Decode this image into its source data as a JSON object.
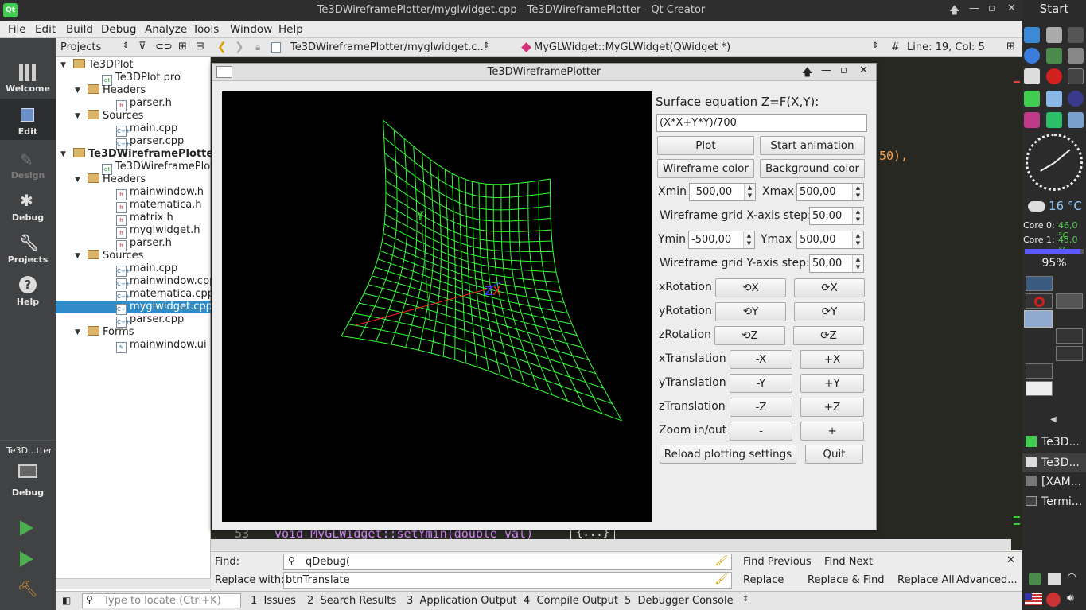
{
  "window": {
    "title": "Te3DWireframePlotter/myglwidget.cpp - Te3DWireframePlotter - Qt Creator"
  },
  "menu": [
    "File",
    "Edit",
    "Build",
    "Debug",
    "Analyze",
    "Tools",
    "Window",
    "Help"
  ],
  "modes": [
    {
      "label": "Welcome",
      "icon": "grid-icon"
    },
    {
      "label": "Edit",
      "icon": "document-icon"
    },
    {
      "label": "Design",
      "icon": "pen-icon"
    },
    {
      "label": "Debug",
      "icon": "bug-icon"
    },
    {
      "label": "Projects",
      "icon": "wrench-icon"
    },
    {
      "label": "Help",
      "icon": "help-icon"
    }
  ],
  "kit": {
    "project": "Te3D...tter",
    "config": "Debug"
  },
  "projects": {
    "header": "Projects",
    "tree": [
      {
        "label": "Te3DPlot",
        "level": 0,
        "type": "project"
      },
      {
        "label": "Te3DPlot.pro",
        "level": 1,
        "type": "pro"
      },
      {
        "label": "Headers",
        "level": 1,
        "type": "folder"
      },
      {
        "label": "parser.h",
        "level": 2,
        "type": "h"
      },
      {
        "label": "Sources",
        "level": 1,
        "type": "folder"
      },
      {
        "label": "main.cpp",
        "level": 2,
        "type": "cpp"
      },
      {
        "label": "parser.cpp",
        "level": 2,
        "type": "cpp"
      },
      {
        "label": "Te3DWireframePlotte",
        "level": 0,
        "type": "project",
        "bold": true
      },
      {
        "label": "Te3DWireframePlotte",
        "level": 1,
        "type": "pro"
      },
      {
        "label": "Headers",
        "level": 1,
        "type": "folder"
      },
      {
        "label": "mainwindow.h",
        "level": 2,
        "type": "h"
      },
      {
        "label": "matematica.h",
        "level": 2,
        "type": "h"
      },
      {
        "label": "matrix.h",
        "level": 2,
        "type": "h"
      },
      {
        "label": "myglwidget.h",
        "level": 2,
        "type": "h"
      },
      {
        "label": "parser.h",
        "level": 2,
        "type": "h"
      },
      {
        "label": "Sources",
        "level": 1,
        "type": "folder"
      },
      {
        "label": "main.cpp",
        "level": 2,
        "type": "cpp"
      },
      {
        "label": "mainwindow.cpp",
        "level": 2,
        "type": "cpp"
      },
      {
        "label": "matematica.cpp",
        "level": 2,
        "type": "cpp"
      },
      {
        "label": "myglwidget.cpp",
        "level": 2,
        "type": "cpp",
        "selected": true
      },
      {
        "label": "parser.cpp",
        "level": 2,
        "type": "cpp"
      },
      {
        "label": "Forms",
        "level": 1,
        "type": "folder"
      },
      {
        "label": "mainwindow.ui",
        "level": 2,
        "type": "ui"
      }
    ]
  },
  "editor": {
    "file": "Te3DWireframePlotter/myglwidget.c...",
    "symbol": "MyGLWidget::MyGLWidget(QWidget *)",
    "hash": "#",
    "position": "Line: 19, Col: 5",
    "visible_code_fragment": "50),",
    "bottom_line_no": "53",
    "bottom_line_code": "void MyGLWidget::setYmin(double val)",
    "fold": "{...}"
  },
  "find": {
    "find_label": "Find:",
    "find_value": "qDebug(",
    "replace_label": "Replace with:",
    "replace_value": "btnTranslate",
    "find_previous": "Find Previous",
    "find_next": "Find Next",
    "replace": "Replace",
    "replace_find": "Replace & Find",
    "replace_all": "Replace All",
    "advanced": "Advanced..."
  },
  "status": {
    "locate_placeholder": "Type to locate (Ctrl+K)",
    "panes": [
      "1  Issues",
      "2  Search Results",
      "3  Application Output",
      "4  Compile Output",
      "5  Debugger Console"
    ]
  },
  "dialog": {
    "title": "Te3DWireframePlotter",
    "equation_label": "Surface equation Z=F(X,Y):",
    "equation_value": "(X*X+Y*Y)/700",
    "plot": "Plot",
    "start_animation": "Start animation",
    "wireframe_color": "Wireframe color ...",
    "background_color": "Background color ...",
    "xmin_label": "Xmin",
    "xmin": "-500,00",
    "xmax_label": "Xmax",
    "xmax": "500,00",
    "xstep_label": "Wireframe grid X-axis step:",
    "xstep": "50,00",
    "ymin_label": "Ymin",
    "ymin": "-500,00",
    "ymax_label": "Ymax",
    "ymax": "500,00",
    "ystep_label": "Wireframe grid Y-axis step:",
    "ystep": "50,00",
    "rows": [
      {
        "label": "xRotation",
        "minus": "⟲X",
        "plus": "⟳X"
      },
      {
        "label": "yRotation",
        "minus": "⟲Y",
        "plus": "⟳Y"
      },
      {
        "label": "zRotation",
        "minus": "⟲Z",
        "plus": "⟳Z"
      },
      {
        "label": "xTranslation",
        "minus": "-X",
        "plus": "+X"
      },
      {
        "label": "yTranslation",
        "minus": "-Y",
        "plus": "+Y"
      },
      {
        "label": "zTranslation",
        "minus": "-Z",
        "plus": "+Z"
      },
      {
        "label": "Zoom in/out",
        "minus": "-",
        "plus": "+"
      }
    ],
    "reload": "Reload plotting settings",
    "quit": "Quit",
    "axis_y": "Y",
    "axis_z": "Z",
    "axis_x": "X",
    "wire_color": "#33ff33"
  },
  "taskbar": {
    "start": "Start",
    "weather": "16 °C",
    "core0_label": "Core 0:",
    "core0": "46,0 °C",
    "core1_label": "Core 1:",
    "core1": "45,0 °C",
    "battery": "95%",
    "tasks": [
      "Te3D...",
      "Te3D...",
      "[XAM...",
      "Termi..."
    ]
  }
}
